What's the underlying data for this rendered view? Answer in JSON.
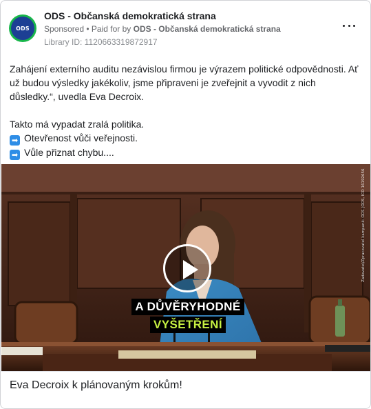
{
  "header": {
    "page_name": "ODS - Občanská demokratická strana",
    "avatar_text": "ODS",
    "sponsored_label": "Sponsored",
    "separator": " • ",
    "paid_for_prefix": "Paid for by ",
    "paid_for_name": "ODS - Občanská demokratická strana",
    "library_id": "Library ID: 1120663319872917",
    "more_icon": "more-horizontal-icon"
  },
  "post": {
    "paragraph1": "Zahájení externího auditu nezávislou firmou je výrazem politické odpovědnosti. Ať už budou výsledky jakékoliv, jsme připraveni je zveřejnit a vyvodit z nich důsledky.“, uvedla Eva Decroix.",
    "paragraph2": "Takto má vypadat zralá politika.",
    "bullet_icon": "➡",
    "bullet1": "Otevřenost vůči veřejnosti.",
    "bullet2": "Vůle přiznat chybu...."
  },
  "video": {
    "caption_line1": "A DŮVĚRYHODNÉ",
    "caption_line2": "VYŠETŘENÍ",
    "side_disclaimer": "Zadavatel/Zpracovatel kampaně: ODS (ODS, IČO 16192656, TOP 09)",
    "play_icon": "play-icon",
    "caption_highlight_color": "#c6f042"
  },
  "footer": {
    "title": "Eva Decroix k plánovaným krokům!"
  },
  "colors": {
    "avatar_ring": "#18b64a",
    "avatar_fill": "#1c3f94",
    "meta_text": "#65676b"
  }
}
